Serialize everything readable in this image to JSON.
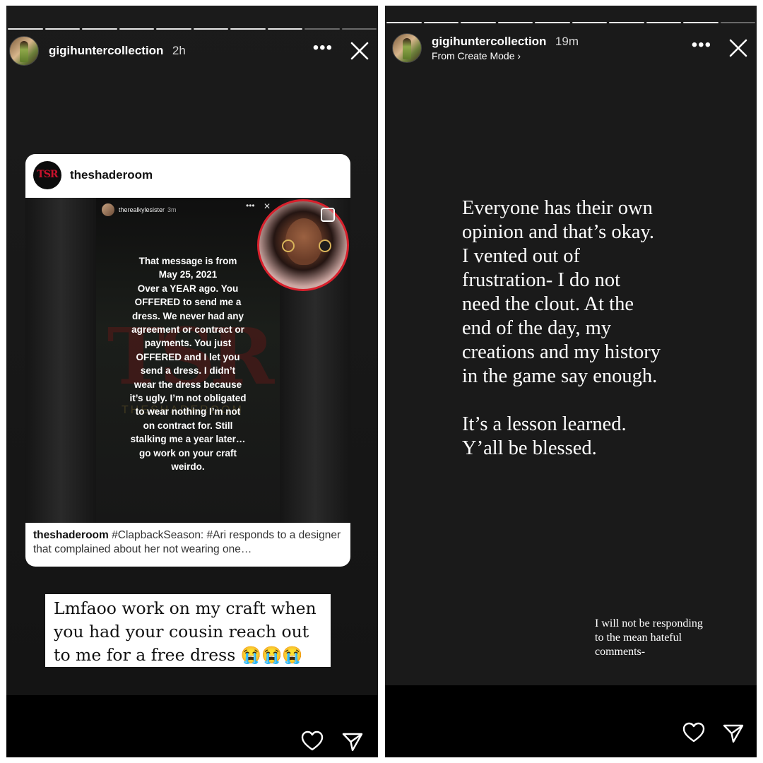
{
  "left_story": {
    "account": {
      "username": "gigihuntercollection",
      "time": "2h"
    },
    "progress_segments": 10,
    "progress_done": 8,
    "post": {
      "account": "theshaderoom",
      "logo_text": "TSR",
      "inner_story": {
        "username": "therealkylesister",
        "time": "3m",
        "message": "That message is from\nMay 25, 2021\nOver a YEAR ago. You\nOFFERED to send me a\ndress. We never had any\nagreement or contract or\npayments. You just\nOFFERED and I let you\nsend a dress. I didn’t\nwear the dress because\nit’s ugly. I’m not obligated\nto wear nothing I’m not\non contract for. Still\nstalking me a year later…\ngo work on your craft\nweirdo.",
        "watermark": "TSR",
        "watermark_sub": "THESHADEROOM"
      },
      "caption_user": "theshaderoom",
      "caption_text": "#ClapbackSeason: #Ari responds to a designer that complained about her not wearing one…"
    },
    "overlay_text": "Lmfaoo work on my craft when you had your cousin reach out to me for a free dress 😭😭😭",
    "icons": {
      "more": "more-icon",
      "close": "close-icon",
      "like": "heart-icon",
      "share": "send-icon"
    }
  },
  "right_story": {
    "account": {
      "username": "gigihuntercollection",
      "time": "19m",
      "subline": "From Create Mode ›"
    },
    "progress_segments": 10,
    "progress_done": 9,
    "main_text": "Everyone has their own\nopinion and that’s okay.\nI vented out of\nfrustration- I do not\nneed the clout. At the\nend of the day, my\ncreations and my history\nin the game say enough.\n\nIt’s a lesson learned.\nY’all be blessed.",
    "note_text": "I will not be responding\nto the mean hateful\ncomments-",
    "icons": {
      "more": "more-icon",
      "close": "close-icon",
      "like": "heart-icon",
      "share": "send-icon"
    }
  },
  "colors": {
    "story_bg": "#1a1a1a",
    "text": "#ffffff",
    "tsr_red": "#c8122c",
    "circle_border": "#d8202c"
  }
}
